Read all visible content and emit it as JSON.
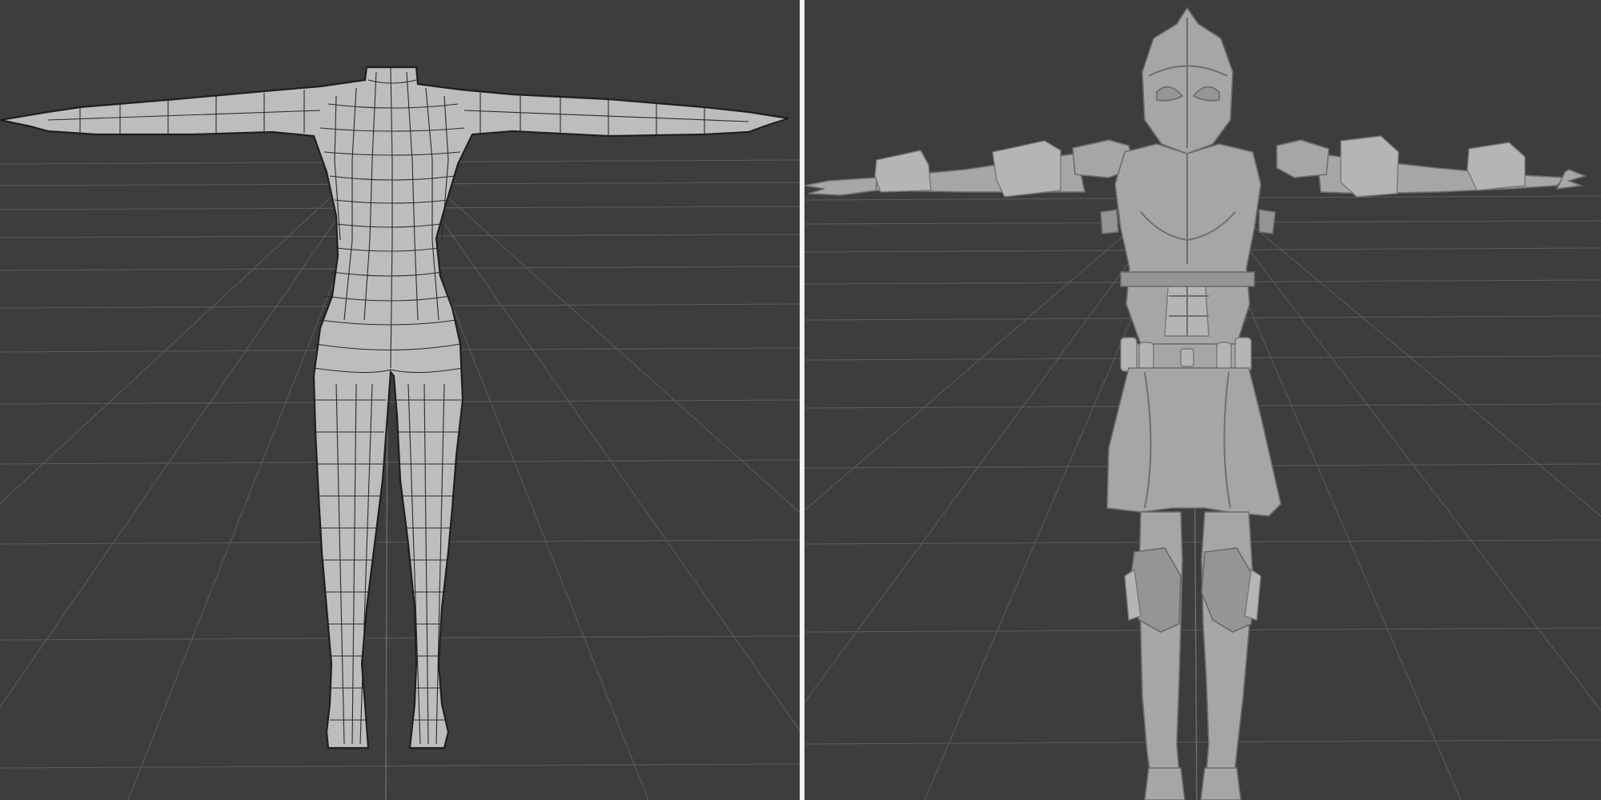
{
  "viewports": [
    {
      "id": "left",
      "content": "wireframe-base-mesh",
      "background": "#3d3d3d"
    },
    {
      "id": "right",
      "content": "armored-character-solid",
      "background": "#3d3d3d"
    }
  ],
  "colors": {
    "background": "#3d3d3d",
    "grid": "#5a5a5a",
    "divider": "#f2f2f2",
    "mesh": "#bdbdbd",
    "solid": "#a6a6a6"
  }
}
